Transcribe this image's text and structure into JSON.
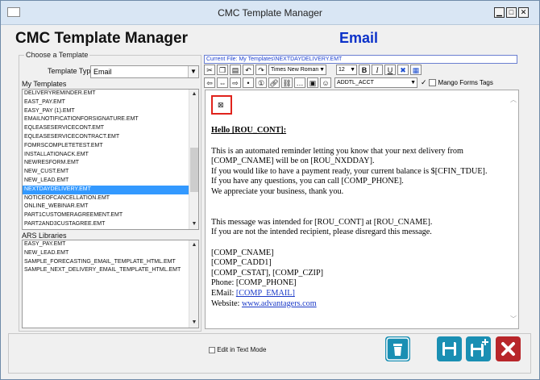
{
  "window": {
    "title": "CMC Template Manager"
  },
  "header": {
    "app_name": "CMC Template Manager",
    "mode": "Email"
  },
  "choose": {
    "legend": "Choose a Template",
    "template_type_label": "Template Type",
    "template_type_value": "Email",
    "my_templates_label": "My Templates",
    "my_templates": [
      "DELIVERYREMINDER.EMT",
      "EAST_PAY.EMT",
      "EASY_PAY (1).EMT",
      "EMAILNOTIFICATIONFORSIGNATURE.EMT",
      "EQLEASESERVICECONT.EMT",
      "EQLEASESERVICECONTRACT.EMT",
      "FOMRSCOMPLETETEST.EMT",
      "INSTALLATIONACK.EMT",
      "NEWRESFORM.EMT",
      "NEW_CUST.EMT",
      "NEW_LEAD.EMT",
      "NEXTDAYDELIVERY.EMT",
      "NOTICEOFCANCELLATION.EMT",
      "ONLINE_WEBINAR.EMT",
      "PART1CUSTOMERAGREEMENT.EMT",
      "PART2AND3CUSTAGREE.EMT"
    ],
    "selected_template": "NEXTDAYDELIVERY.EMT",
    "ars_label": "ARS Libraries",
    "ars_libraries": [
      "EASY_PAY.EMT",
      "NEW_LEAD.EMT",
      "SAMPLE_FORECASTING_EMAIL_TEMPLATE_HTML.EMT",
      "SAMPLE_NEXT_DELIVERY_EMAIL_TEMPLATE_HTML.EMT"
    ]
  },
  "editor": {
    "current_file": "Current File: My Templates\\NEXTDAYDELIVERY.EMT",
    "font_name": "Times New Roman",
    "font_size": "12",
    "field_select": "ADDTL_ACCT",
    "mango_label": "Mango Forms Tags",
    "hello": "Hello [ROU_CONT]:",
    "lines": [
      "This is an automated reminder letting you know that your next delivery from",
      "[COMP_CNAME] will be on [ROU_NXDDAY].",
      "If you would like to have a payment ready, your current balance is $[CFIN_TDUE].",
      "If you have any questions, you can call [COMP_PHONE].",
      "We appreciate your business, thank you."
    ],
    "lines2": [
      "This message was intended for [ROU_CONT] at [ROU_CNAME].",
      "If you are not the intended recipient, please disregard this message."
    ],
    "lines3": [
      "[COMP_CNAME]",
      "[COMP_CADD1]",
      "[COMP_CSTAT], [COMP_CZIP]",
      "Phone: [COMP_PHONE]"
    ],
    "email_label": "EMail: ",
    "email_link": "[COMP_EMAIL]",
    "website_label": "Website: ",
    "website_link": "www.advantagers.com"
  },
  "footer": {
    "edit_text_mode_label": "Edit in Text Mode"
  },
  "colors": {
    "accent_blue": "#0b31c9",
    "selection": "#3399ff",
    "delete_red": "#b8262a",
    "teal": "#1a8fb3"
  }
}
